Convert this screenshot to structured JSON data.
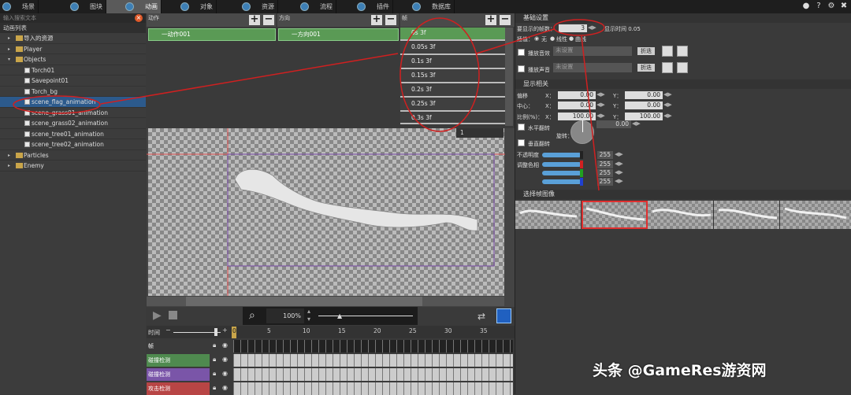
{
  "tabs": [
    {
      "label": "场景"
    },
    {
      "label": "图块"
    },
    {
      "label": "动画"
    },
    {
      "label": "对象"
    },
    {
      "label": "资源"
    },
    {
      "label": "流程"
    },
    {
      "label": "插件"
    },
    {
      "label": "数据库"
    }
  ],
  "left": {
    "search_placeholder": "输入搜索文本",
    "tree_header": "动画列表",
    "items": [
      {
        "label": "导入的资源"
      },
      {
        "label": "Player"
      },
      {
        "label": "Objects"
      },
      {
        "label": "Torch01"
      },
      {
        "label": "Savepoint01"
      },
      {
        "label": "Torch_bg"
      },
      {
        "label": "scene_flag_animation"
      },
      {
        "label": "scene_grass01_animation"
      },
      {
        "label": "scene_grass02_animation"
      },
      {
        "label": "scene_tree01_animation"
      },
      {
        "label": "scene_tree02_animation"
      },
      {
        "label": "Particles"
      },
      {
        "label": "Enemy"
      }
    ]
  },
  "columns": {
    "action": "动作",
    "direction": "方向",
    "frame": "帧",
    "action_item": "一动作001",
    "direction_item": "一方向001"
  },
  "frames": [
    {
      "label": "0s 3f"
    },
    {
      "label": "0.05s 3f"
    },
    {
      "label": "0.1s 3f"
    },
    {
      "label": "0.15s 3f"
    },
    {
      "label": "0.2s 3f"
    },
    {
      "label": "0.25s 3f"
    },
    {
      "label": "0.3s 3f"
    }
  ],
  "canvas": {
    "frame_select": "1"
  },
  "playbar": {
    "zoom": "100%"
  },
  "timeline": {
    "time_label": "时间",
    "ticks": [
      "0",
      "5",
      "10",
      "15",
      "20",
      "25",
      "30",
      "35"
    ],
    "rows": [
      {
        "label": "帧",
        "color": "#3a3a3a"
      },
      {
        "label": "碰撞检测",
        "color": "#4f8a4f"
      },
      {
        "label": "碰撞检测",
        "color": "#7a55a8"
      },
      {
        "label": "攻击检测",
        "color": "#b84545"
      }
    ]
  },
  "right": {
    "basic_title": "基础设置",
    "show_frames_label": "要显示的帧数：",
    "show_frames_value": "3",
    "display_time": "显示时间 0.05",
    "interp_label": "插值：",
    "interp_none": "无",
    "interp_linear": "线性",
    "interp_curve": "曲线",
    "play_sound1": "播放音效",
    "play_sound2": "播放声音",
    "not_set": "未设置",
    "speed_btn": "折迭",
    "display_title": "显示相关",
    "offset": "偏移",
    "center": "中心：",
    "scale": "比例(%)：",
    "x_label": "X：",
    "y_label": "Y：",
    "offset_x": "0.00",
    "offset_y": "0.00",
    "center_x": "0.00",
    "center_y": "0.00",
    "scale_x": "100.00",
    "scale_y": "100.00",
    "hflip": "水平翻转",
    "rotation_label": "旋转：",
    "rotation": "0.00",
    "vflip": "垂直翻转",
    "opacity": "不透明度",
    "tint": "调整色相",
    "opacity_value": "255",
    "tint_values": [
      "255",
      "255",
      "255"
    ],
    "select_title": "选择帧图像"
  },
  "watermark": "头条 @GameRes游资网"
}
